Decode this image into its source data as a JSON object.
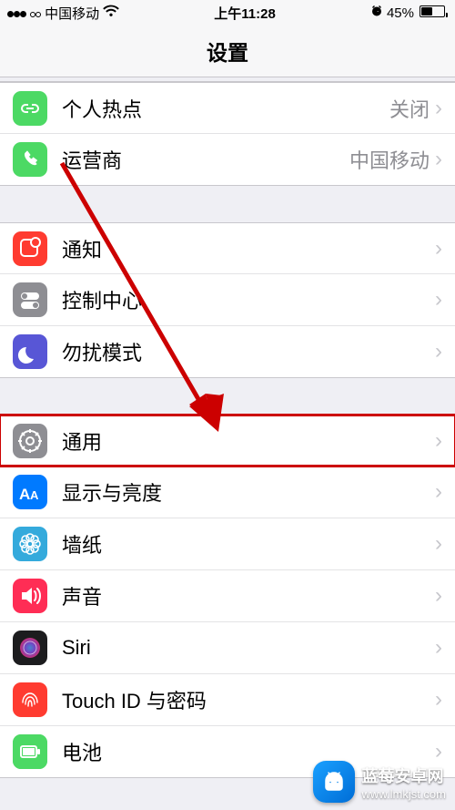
{
  "status_bar": {
    "carrier": "中国移动",
    "time": "上午11:28",
    "battery_percent": "45%"
  },
  "page_title": "设置",
  "rows": {
    "hotspot": {
      "label": "个人热点",
      "detail": "关闭"
    },
    "carrier": {
      "label": "运营商",
      "detail": "中国移动"
    },
    "notifications": {
      "label": "通知"
    },
    "control": {
      "label": "控制中心"
    },
    "dnd": {
      "label": "勿扰模式"
    },
    "general": {
      "label": "通用"
    },
    "display": {
      "label": "显示与亮度"
    },
    "wallpaper": {
      "label": "墙纸"
    },
    "sound": {
      "label": "声音"
    },
    "siri": {
      "label": "Siri"
    },
    "touchid": {
      "label": "Touch ID 与密码"
    },
    "battery": {
      "label": "电池"
    }
  },
  "icon_colors": {
    "green": "#4cd964",
    "red": "#ff3b30",
    "gray": "#8e8e93",
    "purple": "#5856d6",
    "blueA": "#007aff",
    "cyan": "#34aadc",
    "pink": "#fd5b78"
  },
  "watermark": {
    "name": "蓝莓安卓网",
    "url": "www.lmkjst.com"
  }
}
